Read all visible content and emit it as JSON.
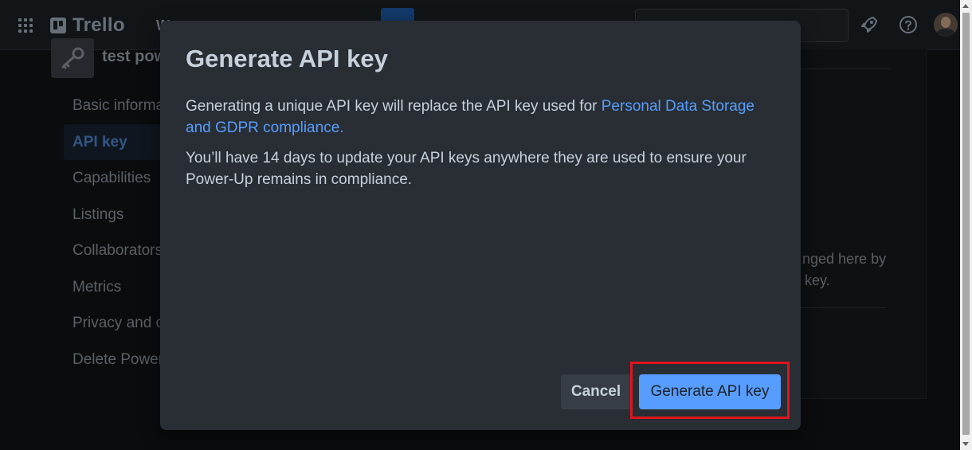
{
  "topbar": {
    "app_name": "Trello",
    "workspaces_fragment": "W"
  },
  "powerup": {
    "title_fragment": "test pow"
  },
  "sidebar": {
    "items": [
      {
        "label": "Basic informa",
        "active": false
      },
      {
        "label": "API key",
        "active": true
      },
      {
        "label": "Capabilities",
        "active": false
      },
      {
        "label": "Listings",
        "active": false
      },
      {
        "label": "Collaborators",
        "active": false
      },
      {
        "label": "Metrics",
        "active": false
      },
      {
        "label": "Privacy and co",
        "active": false
      },
      {
        "label": "Delete Power",
        "active": false
      }
    ]
  },
  "background_content": {
    "line1": "nged here by",
    "line2": "key."
  },
  "modal": {
    "title": "Generate API key",
    "paragraph1_text": "Generating a unique API key will replace the API key used for ",
    "paragraph1_link": "Personal Data Storage and GDPR compliance.",
    "paragraph2": "You’ll have 14 days to update your API keys anywhere they are used to ensure your Power-Up remains in compliance.",
    "cancel_label": "Cancel",
    "generate_label": "Generate API key"
  },
  "colors": {
    "accent": "#579dff",
    "highlight": "#e0141e",
    "modal_bg": "#282e33"
  }
}
